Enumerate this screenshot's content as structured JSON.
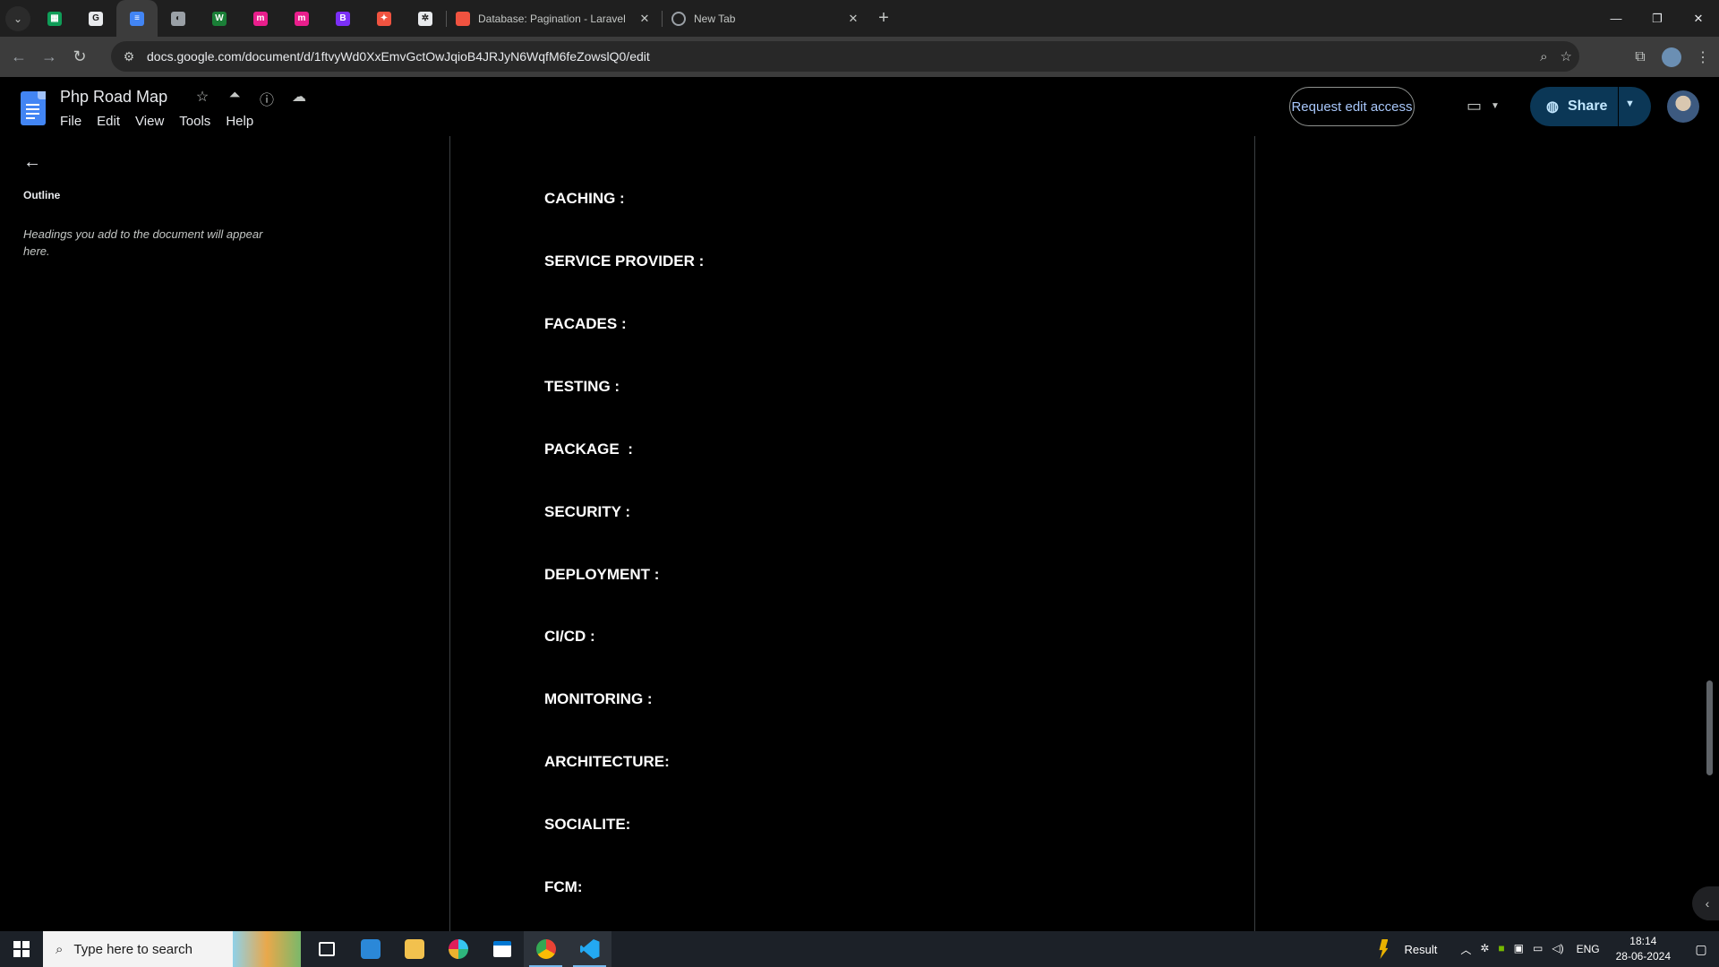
{
  "browser": {
    "tabs": [
      {
        "label": "Database: Pagination - Laravel",
        "favicon_color": "#f05340"
      },
      {
        "label": "New Tab",
        "favicon_color": "#9aa0a6"
      }
    ],
    "pinned_tabs": [
      {
        "name": "sheets",
        "color": "#0f9d58",
        "glyph": "▦"
      },
      {
        "name": "google",
        "color": "#e8eaed",
        "glyph": "G"
      },
      {
        "name": "docs",
        "color": "#4285f4",
        "glyph": "≡"
      },
      {
        "name": "site",
        "color": "#9aa0a6",
        "glyph": "◐"
      },
      {
        "name": "w",
        "color": "#1a7f37",
        "glyph": "W"
      },
      {
        "name": "m1",
        "color": "#e91e8c",
        "glyph": "m"
      },
      {
        "name": "m2",
        "color": "#e91e8c",
        "glyph": "m"
      },
      {
        "name": "b",
        "color": "#7b2ff7",
        "glyph": "B"
      },
      {
        "name": "laravel",
        "color": "#f05340",
        "glyph": "✦"
      },
      {
        "name": "chatgpt",
        "color": "#e8eaed",
        "glyph": "✲"
      }
    ],
    "url": "docs.google.com/document/d/1ftvyWd0XxEmvGctOwJqioB4JRJyN6WqfM6feZowslQ0/edit"
  },
  "docs": {
    "title": "Php Road Map",
    "menu": [
      "File",
      "Edit",
      "View",
      "Tools",
      "Help"
    ],
    "request_edit_label": "Request edit access",
    "share_label": "Share",
    "outline": {
      "title": "Outline",
      "hint": "Headings you add to the document will appear here."
    },
    "headings": [
      "CACHING :",
      "SERVICE PROVIDER :",
      "FACADES :",
      "TESTING :",
      "PACKAGE  :",
      "SECURITY :",
      "DEPLOYMENT :",
      "CI/CD :",
      "MONITORING :",
      "ARCHITECTURE:",
      "SOCIALITE:",
      "FCM:"
    ]
  },
  "taskbar": {
    "search_placeholder": "Type here to search",
    "weather_label": "Result",
    "language": "ENG",
    "time": "18:14",
    "date": "28-06-2024"
  }
}
